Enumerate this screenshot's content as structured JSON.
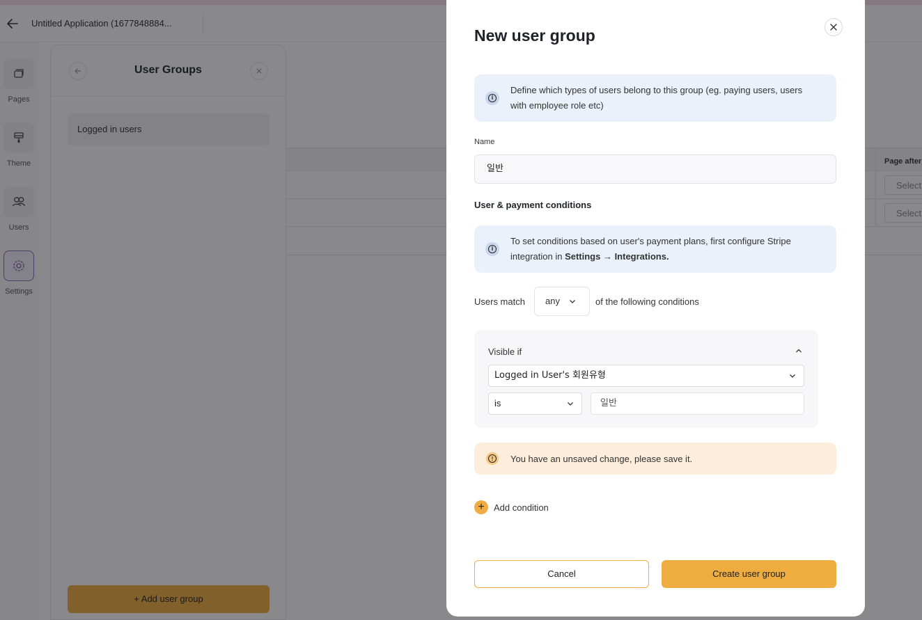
{
  "app": {
    "title": "Untitled Application (1677848884..."
  },
  "nav": [
    {
      "label": "Pages",
      "icon": "pages-icon"
    },
    {
      "label": "Theme",
      "icon": "theme-icon"
    },
    {
      "label": "Users",
      "icon": "users-icon"
    },
    {
      "label": "Settings",
      "icon": "settings-icon"
    }
  ],
  "user_groups": {
    "title": "User Groups",
    "items": [
      "Logged in users"
    ],
    "add_button": "+ Add user group"
  },
  "background_table": {
    "column_header": "Page after",
    "select_placeholder": "Select"
  },
  "modal": {
    "title": "New user group",
    "info_text": "Define which types of users belong to this group (eg. paying users, users with employee role etc)",
    "name_label": "Name",
    "name_value": "일반",
    "conditions_title": "User & payment conditions",
    "stripe_info_prefix": "To set conditions based on user's payment plans, first configure Stripe integration in ",
    "stripe_info_link": "Settings → Integrations.",
    "match_prefix": "Users match",
    "match_value": "any",
    "match_suffix": "of the following conditions",
    "condition": {
      "label": "Visible if",
      "field": "Logged in User's 회원유형",
      "operator": "is",
      "value": "일반"
    },
    "warning_text": "You have an unsaved change, please save it.",
    "add_condition_label": "Add condition",
    "cancel_label": "Cancel",
    "create_label": "Create user group"
  },
  "colors": {
    "accent": "#eeac41",
    "info_bg": "#ebf1fa",
    "warning_bg": "#fdeedb",
    "overlay": "rgba(20,20,24,0.50)"
  }
}
